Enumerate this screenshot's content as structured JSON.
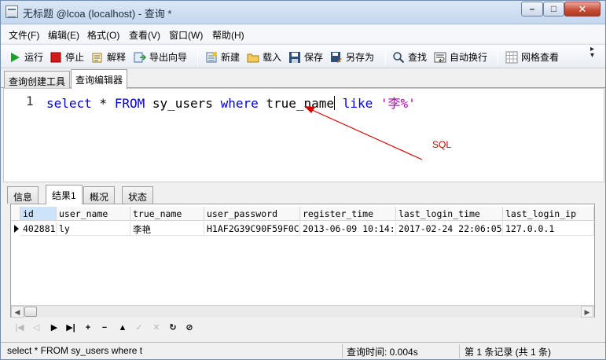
{
  "window": {
    "title": "无标题 @lcoa (localhost) - 查询 *",
    "controls": {
      "minimize": "–",
      "maximize": "□",
      "close": "✕"
    }
  },
  "menu": {
    "items": [
      "文件(F)",
      "编辑(E)",
      "格式(O)",
      "查看(V)",
      "窗口(W)",
      "帮助(H)"
    ]
  },
  "toolbar": {
    "run": "运行",
    "stop": "停止",
    "explain": "解释",
    "export_wizard": "导出向导",
    "new": "新建",
    "load": "载入",
    "save": "保存",
    "save_as": "另存为",
    "find": "查找",
    "word_wrap": "自动换行",
    "grid_view": "网格查看",
    "more": "»"
  },
  "outer_tabs": [
    "查询创建工具",
    "查询编辑器"
  ],
  "editor": {
    "line_number": "1",
    "tokens": {
      "t1": "select",
      "t2": " * ",
      "t3": "FROM",
      "t4": " sy_users ",
      "t5": "where",
      "t6": " true_name",
      "t7": " like ",
      "t8": "'李%'"
    }
  },
  "annotation": {
    "label": "SQL",
    "color": "#d40000"
  },
  "result_tabs": [
    "信息",
    "结果1",
    "概况",
    "状态"
  ],
  "grid": {
    "columns": [
      "id",
      "user_name",
      "true_name",
      "user_password",
      "register_time",
      "last_login_time",
      "last_login_ip"
    ],
    "rows": [
      [
        "402881",
        "ly",
        "李艳",
        "H1AF2G39C90F59F0C",
        "2013-06-09 10:14:",
        "2017-02-24 22:06:05",
        "127.0.0.1"
      ]
    ]
  },
  "navigator": {
    "buttons": [
      "first",
      "prev",
      "next",
      "last",
      "insert",
      "delete",
      "up",
      "apply",
      "cancel",
      "refresh",
      "stop"
    ]
  },
  "status": {
    "sql": "select * FROM sy_users where t",
    "query_time": "查询时间: 0.004s",
    "record": "第 1 条记录 (共 1 条)"
  }
}
